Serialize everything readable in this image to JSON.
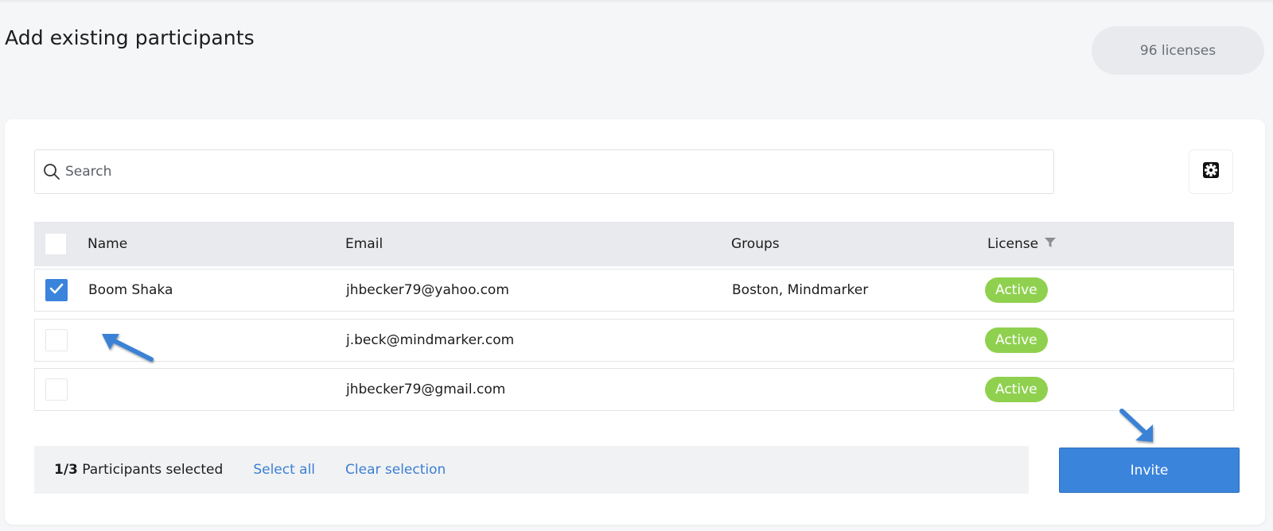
{
  "page": {
    "title": "Add existing participants",
    "licenses_label": "96 licenses"
  },
  "search": {
    "placeholder": "Search",
    "value": ""
  },
  "settings": {
    "icon": "gear-icon"
  },
  "table": {
    "columns": [
      "Name",
      "Email",
      "Groups",
      "License"
    ],
    "license_filter_icon": "filter-icon",
    "rows": [
      {
        "name": "Boom Shaka",
        "email": "jhbecker79@yahoo.com",
        "groups": "Boston, Mindmarker",
        "license": "Active",
        "checked": true
      },
      {
        "name": "",
        "email": "j.beck@mindmarker.com",
        "groups": "",
        "license": "Active",
        "checked": false
      },
      {
        "name": "",
        "email": "jhbecker79@gmail.com",
        "groups": "",
        "license": "Active",
        "checked": false
      }
    ]
  },
  "footer": {
    "selected_count": "1/3",
    "selected_text": "Participants selected",
    "select_all": "Select all",
    "clear_selection": "Clear selection",
    "invite": "Invite"
  },
  "colors": {
    "accent": "#3b84dc",
    "active_badge": "#8fd14f",
    "annotation_arrow": "#3b82d6"
  }
}
